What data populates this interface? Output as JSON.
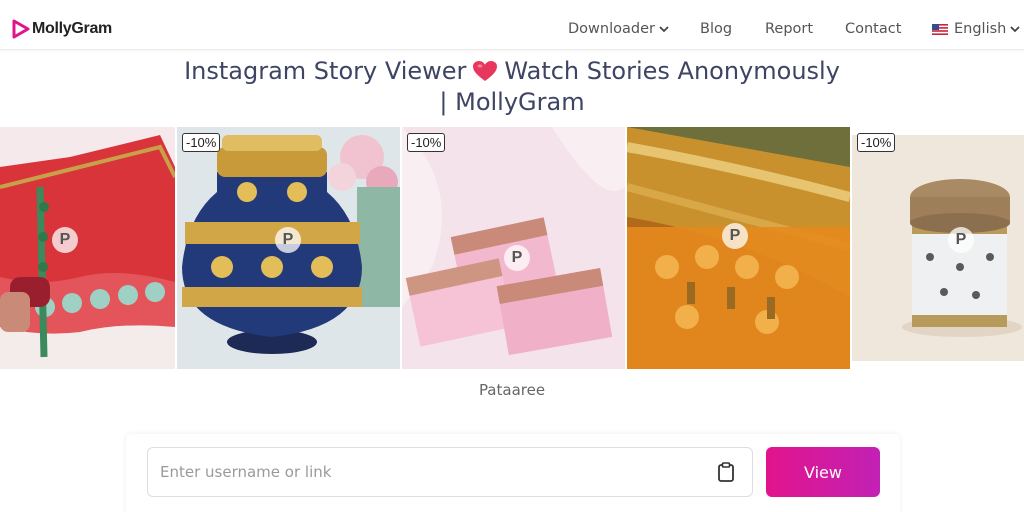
{
  "app": {
    "logo_text": "MollyGram",
    "brand_color": "#e2148c"
  },
  "nav": {
    "downloader": "Downloader",
    "blog": "Blog",
    "report": "Report",
    "contact": "Contact",
    "language": "English"
  },
  "title": {
    "part1": "Instagram Story Viewer",
    "part2": "Watch Stories Anonymously",
    "line2": "| MollyGram"
  },
  "carousel": {
    "badge": "-10%",
    "watermark": "P",
    "caption": "Pataaree",
    "slides": [
      "red-tent-decor",
      "blue-gold-pot",
      "pink-envelopes",
      "orange-gold-fabric",
      "white-jewel-box"
    ]
  },
  "search": {
    "placeholder": "Enter username or link",
    "value": "",
    "button": "View"
  },
  "icons": [
    "play-logo-icon",
    "chevron-down-icon",
    "us-flag-icon",
    "heart-icon",
    "clipboard-icon"
  ]
}
